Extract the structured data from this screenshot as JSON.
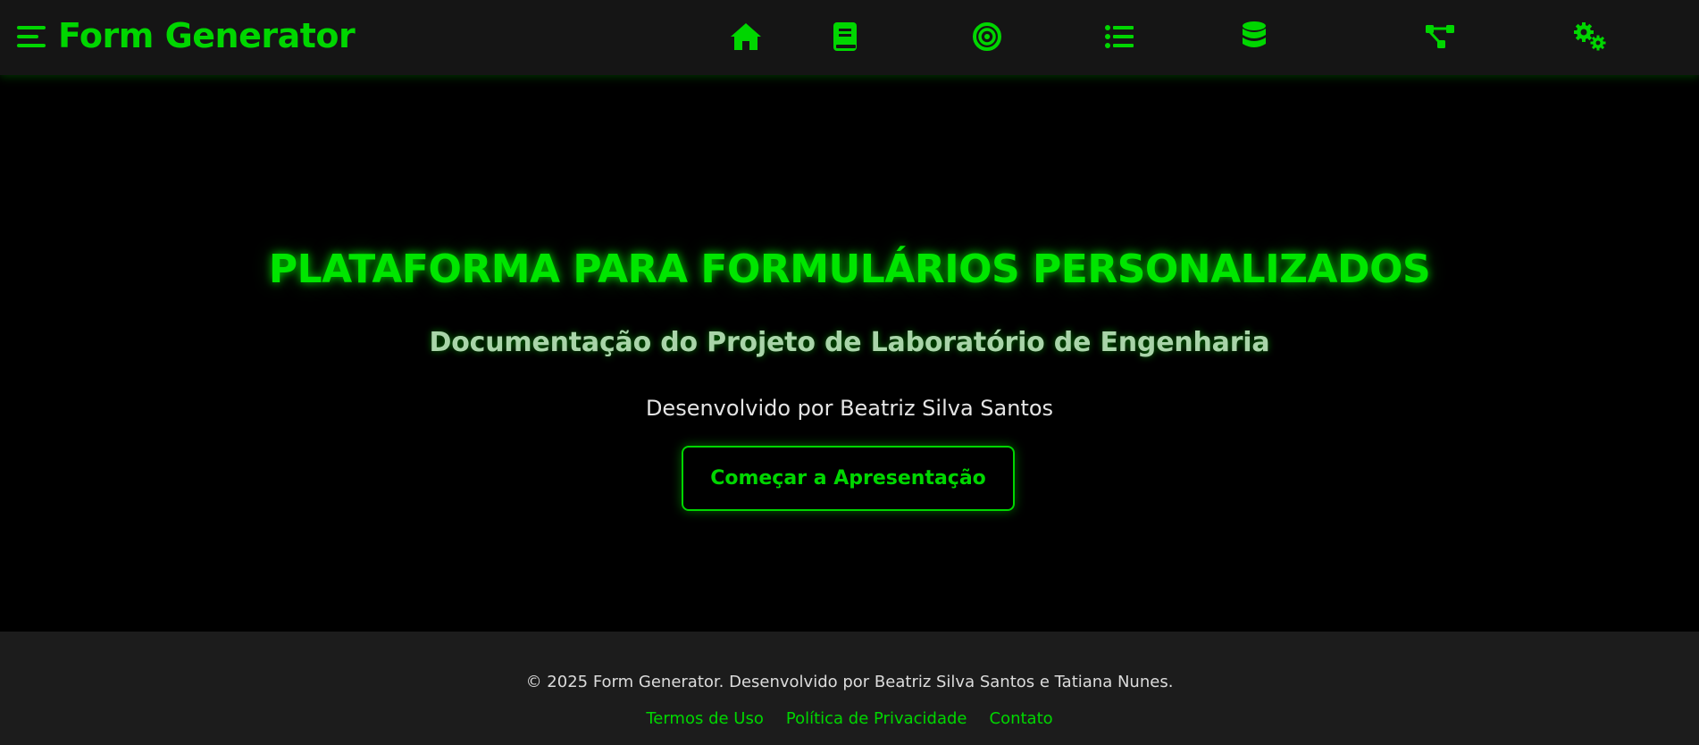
{
  "navbar": {
    "brand": "Form Generator",
    "icons": [
      {
        "name": "home-icon"
      },
      {
        "name": "book-icon"
      },
      {
        "name": "target-icon"
      },
      {
        "name": "list-icon"
      },
      {
        "name": "database-icon"
      },
      {
        "name": "sitemap-icon"
      },
      {
        "name": "gears-icon"
      }
    ]
  },
  "hero": {
    "title": "PLATAFORMA PARA FORMULÁRIOS PERSONALIZADOS",
    "subtitle": "Documentação do Projeto de Laboratório de Engenharia",
    "author": "Desenvolvido por Beatriz Silva Santos",
    "cta_label": "Começar a Apresentação"
  },
  "footer": {
    "copyright": "© 2025 Form Generator. Desenvolvido por Beatriz Silva Santos e Tatiana Nunes.",
    "links": [
      "Termos de Uso",
      "Política de Privacidade",
      "Contato"
    ]
  },
  "colors": {
    "accent": "#00d600",
    "navbar_bg": "#151515",
    "page_bg": "#000000",
    "footer_bg": "#1c1c1c",
    "subtitle": "#a9d4a9"
  }
}
